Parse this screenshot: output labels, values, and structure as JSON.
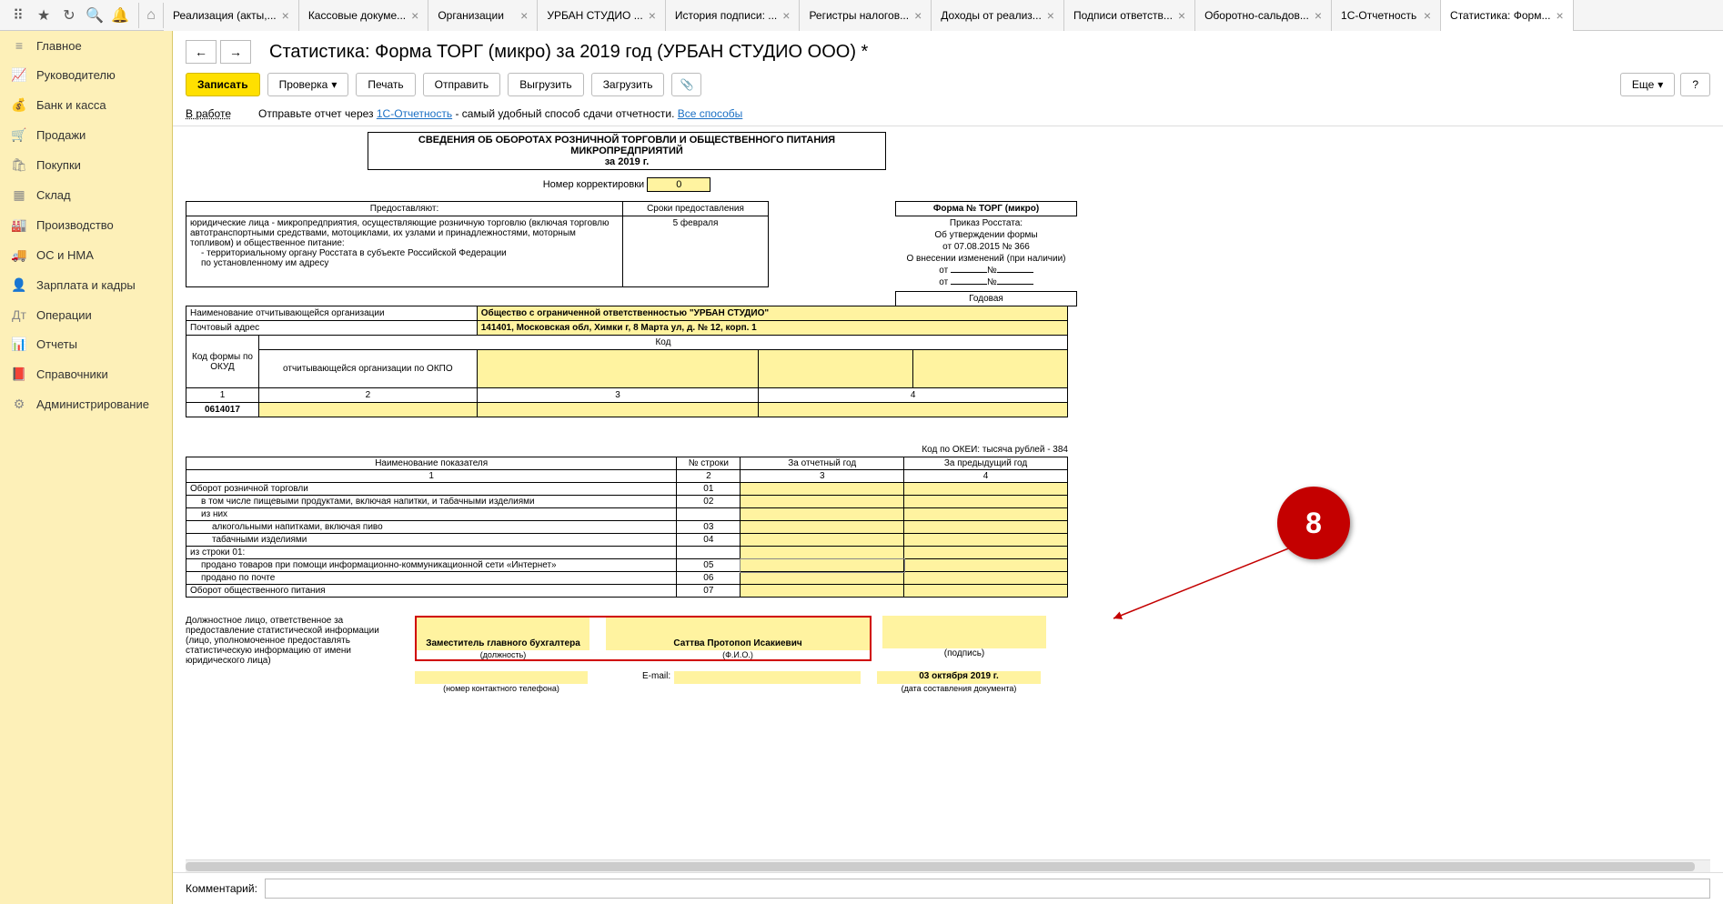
{
  "top_icons": [
    "⠿",
    "★",
    "↻",
    "🔍",
    "🔔"
  ],
  "home_icon": "⌂",
  "tabs": [
    {
      "label": "Реализация (акты,..."
    },
    {
      "label": "Кассовые докуме..."
    },
    {
      "label": "Организации"
    },
    {
      "label": "УРБАН СТУДИО ..."
    },
    {
      "label": "История подписи: ..."
    },
    {
      "label": "Регистры налогов..."
    },
    {
      "label": "Доходы от реализ..."
    },
    {
      "label": "Подписи ответств..."
    },
    {
      "label": "Оборотно-сальдов..."
    },
    {
      "label": "1С-Отчетность"
    },
    {
      "label": "Статистика: Форм...",
      "active": true
    }
  ],
  "sidebar": [
    {
      "icon": "≡",
      "label": "Главное"
    },
    {
      "icon": "📈",
      "label": "Руководителю"
    },
    {
      "icon": "💰",
      "label": "Банк и касса"
    },
    {
      "icon": "🛒",
      "label": "Продажи"
    },
    {
      "icon": "🛍",
      "label": "Покупки"
    },
    {
      "icon": "▦",
      "label": "Склад"
    },
    {
      "icon": "🏭",
      "label": "Производство"
    },
    {
      "icon": "🚚",
      "label": "ОС и НМА"
    },
    {
      "icon": "👤",
      "label": "Зарплата и кадры"
    },
    {
      "icon": "Дт",
      "label": "Операции"
    },
    {
      "icon": "📊",
      "label": "Отчеты"
    },
    {
      "icon": "📕",
      "label": "Справочники"
    },
    {
      "icon": "⚙",
      "label": "Администрирование"
    }
  ],
  "page_title": "Статистика: Форма ТОРГ (микро) за 2019 год (УРБАН СТУДИО ООО) *",
  "actions": {
    "write": "Записать",
    "check": "Проверка",
    "print": "Печать",
    "send": "Отправить",
    "export": "Выгрузить",
    "import": "Загрузить",
    "attach": "📎",
    "more": "Еще",
    "help": "?"
  },
  "info": {
    "status": "В работе",
    "text1": "Отправьте отчет через ",
    "link1": "1С-Отчетность",
    "text2": " - самый удобный способ сдачи отчетности. ",
    "link2": "Все способы"
  },
  "report_header": {
    "line1": "СВЕДЕНИЯ ОБ ОБОРОТАХ РОЗНИЧНОЙ ТОРГОВЛИ И ОБЩЕСТВЕННОГО ПИТАНИЯ",
    "line2": "МИКРОПРЕДПРИЯТИЙ",
    "line3": "за 2019 г."
  },
  "corr": {
    "label": "Номер корректировки",
    "value": "0"
  },
  "provide": {
    "h1": "Предоставляют:",
    "h2": "Сроки предоставления",
    "body": "юридические лица - микропредприятия, осуществляющие  розничную торговлю (включая торговлю автотранспортными средствами, мотоциклами, их узлами и принадлежностями, моторным топливом) и общественное питание:",
    "b2": "- территориальному органу Росстата в субъекте Российской Федерации",
    "b3": "по установленному им адресу",
    "deadline": "5 февраля"
  },
  "form_info": {
    "title": "Форма № ТОРГ (микро)",
    "l1": "Приказ Росстата:",
    "l2": "Об утверждении формы",
    "l3": "от 07.08.2015 № 366",
    "l4": "О внесении изменений (при наличии)",
    "from": "от",
    "num": "№",
    "annual": "Годовая"
  },
  "org": {
    "name_label": "Наименование отчитывающейся организации",
    "name_value": "Общество с ограниченной ответственностью \"УРБАН СТУДИО\"",
    "addr_label": "Почтовый адрес",
    "addr_value": "141401, Московская обл, Химки г, 8 Марта ул, д. № 12, корп. 1",
    "code_header": "Код",
    "okud_label": "Код формы по ОКУД",
    "okpo_label": "отчитывающейся организации по ОКПО",
    "col1": "1",
    "col2": "2",
    "col3": "3",
    "col4": "4",
    "okud_value": "0614017"
  },
  "okei": "Код по ОКЕИ: тысяча рублей - 384",
  "data_headers": {
    "h1": "Наименование показателя",
    "h2": "№ строки",
    "h3": "За отчетный год",
    "h4": "За предыдущий год",
    "n1": "1",
    "n2": "2",
    "n3": "3",
    "n4": "4"
  },
  "data_rows": [
    {
      "name": "Оборот розничной торговли",
      "num": "01",
      "indent": 0
    },
    {
      "name": "в том числе пищевыми продуктами, включая напитки, и табачными изделиями",
      "num": "02",
      "indent": 1
    },
    {
      "name": "из них",
      "num": "",
      "indent": 1
    },
    {
      "name": "алкогольными напитками, включая пиво",
      "num": "03",
      "indent": 2
    },
    {
      "name": "табачными изделиями",
      "num": "04",
      "indent": 2
    },
    {
      "name": "из строки 01:",
      "num": "",
      "indent": 0
    },
    {
      "name": "продано товаров при помощи информационно-коммуникационной сети «Интернет»",
      "num": "05",
      "indent": 1,
      "sel": true
    },
    {
      "name": "продано по почте",
      "num": "06",
      "indent": 1
    },
    {
      "name": "Оборот общественного питания",
      "num": "07",
      "indent": 0
    }
  ],
  "sig": {
    "left": "Должностное лицо, ответственное за предоставление статистической информации (лицо, уполномоченное предоставлять статистическую информацию от имени юридического лица)",
    "pos": "Заместитель главного бухгалтера",
    "pos_cap": "(должность)",
    "name": "Саттва Протопоп Исакиевич",
    "name_cap": "(Ф.И.О.)",
    "sign_cap": "(подпись)",
    "phone_cap": "(номер контактного телефона)",
    "email_label": "E-mail:",
    "date": "03 октября 2019 г.",
    "date_cap": "(дата составления документа)"
  },
  "comment_label": "Комментарий:",
  "annotation": "8"
}
